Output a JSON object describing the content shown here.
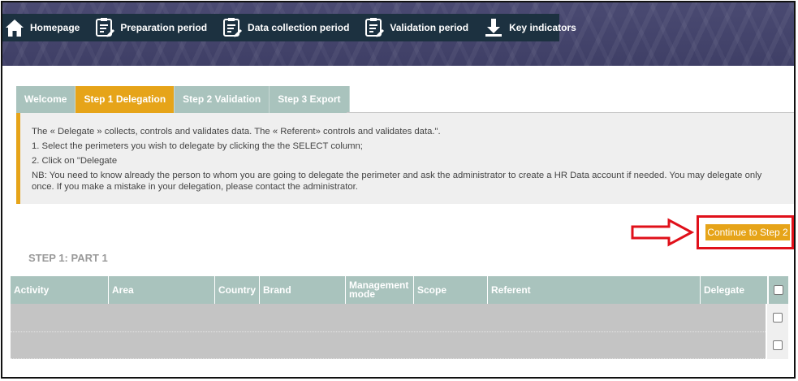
{
  "nav": {
    "items": [
      {
        "label": "Homepage",
        "icon": "home-icon"
      },
      {
        "label": "Preparation period",
        "icon": "clipboard-edit-icon"
      },
      {
        "label": "Data collection period",
        "icon": "clipboard-edit-icon"
      },
      {
        "label": "Validation period",
        "icon": "clipboard-edit-icon"
      },
      {
        "label": "Key indicators",
        "icon": "download-icon"
      }
    ]
  },
  "tabs": [
    {
      "label": "Welcome",
      "active": false
    },
    {
      "label": "Step 1 Delegation",
      "active": true
    },
    {
      "label": "Step 2 Validation",
      "active": false
    },
    {
      "label": "Step 3 Export",
      "active": false
    }
  ],
  "info": {
    "line1": "The « Delegate » collects, controls and validates data. The « Referent» controls and validates data.\".",
    "line2": "1. Select the perimeters you wish to delegate by clicking the the SELECT column;",
    "line3": "2. Click on \"Delegate",
    "line4": "NB: You need to know already the person to whom you are going to delegate the perimeter and ask the administrator to create a HR Data account if needed. You may delegate only once. If you make a mistake in your delegation, please contact the administrator."
  },
  "continue_button": "Continue to Step 2",
  "section_title": "STEP 1: PART 1",
  "table": {
    "columns": [
      "Activity",
      "Area",
      "Country",
      "Brand",
      "Management mode",
      "Scope",
      "Referent",
      "Delegate"
    ],
    "rows": [
      {},
      {}
    ]
  },
  "colors": {
    "accent": "#e6a419",
    "tab_inactive": "#a9c3bd",
    "navbar": "#1c3140",
    "highlight_red": "#e0101a"
  }
}
